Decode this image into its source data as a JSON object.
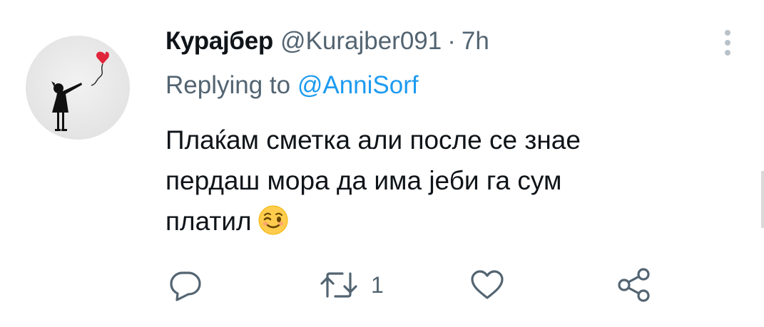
{
  "tweet": {
    "display_name": "Курајбер",
    "handle": "@Kurajber091",
    "separator": "·",
    "time": "7h",
    "replying_prefix": "Replying to",
    "replying_to": "@AnniSorf",
    "text_lines": [
      "Плаќам сметка али после се знае",
      "пердаш мора да има јеби га сум",
      "платил"
    ],
    "emoji": "winking-face",
    "retweet_count": "1",
    "like_count": ""
  },
  "icons": {
    "more": "more-vertical-icon",
    "reply": "reply-icon",
    "retweet": "retweet-icon",
    "like": "heart-icon",
    "share": "share-icon"
  },
  "colors": {
    "text": "#0f1419",
    "secondary": "#536471",
    "link": "#1d9bf0",
    "icon": "#536471"
  }
}
